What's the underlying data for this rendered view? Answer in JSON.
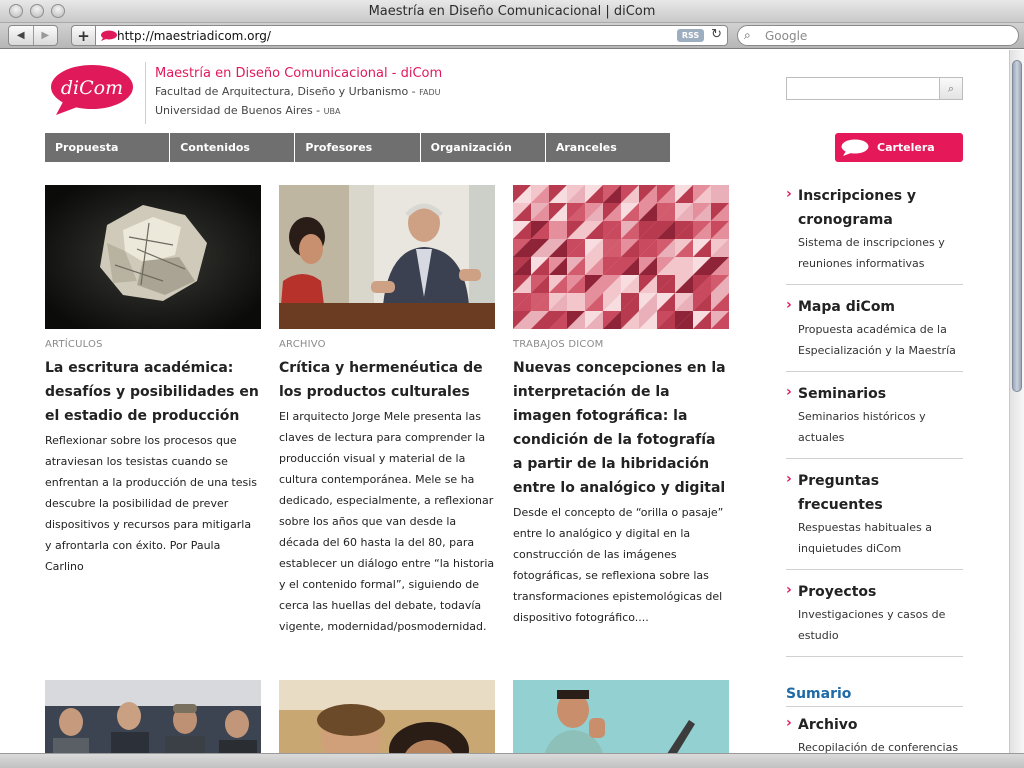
{
  "browser": {
    "window_title": "Maestría en Diseño Comunicacional | diCom",
    "url": "http://maestriadicom.org/",
    "rss_label": "RSS",
    "search_placeholder": "Google"
  },
  "site": {
    "logo_text": "diCom",
    "title": "Maestría en Diseño Comunicacional - diCom",
    "subtitle1": "Facultad de Arquitectura, Diseño y Urbanismo - ",
    "subtitle1_small": "FADU",
    "subtitle2": "Universidad de Buenos Aires - ",
    "subtitle2_small": "UBA"
  },
  "nav": {
    "items": [
      "Propuesta",
      "Contenidos",
      "Profesores",
      "Organización",
      "Aranceles"
    ],
    "cartelera": "Cartelera"
  },
  "articles": [
    {
      "category": "ARTÍCULOS",
      "title": "La escritura académica: desafíos y posibilidades en el estadio de producción",
      "body": "Reflexionar sobre los procesos que atraviesan los tesistas cuando se enfrentan a la producción de una tesis descubre la posibilidad de prever dispositivos y recursos para mitigarla y afrontarla con éxito. Por Paula Carlino"
    },
    {
      "category": "ARCHIVO",
      "title": "Crítica y hermenéutica de los productos culturales",
      "body": "El arquitecto Jorge Mele presenta las claves de lectura para comprender la producción visual y material de la cultura contemporánea. Mele se ha dedicado, especialmente, a reflexionar sobre los años que van desde la década del 60 hasta la del 80, para establecer un diálogo entre “la historia y el contenido formal”, siguiendo de cerca las huellas del debate, todavía vigente, modernidad/posmodernidad."
    },
    {
      "category": "TRABAJOS DICOM",
      "title": "Nuevas concepciones en la interpretación de la imagen fotográfica: la condición de la fotografía a partir de la hibridación entre lo analógico y digital",
      "body": "Desde el concepto de “orilla o pasaje” entre lo analógico y digital en la construcción de las imágenes fotográficas, se reflexiona sobre las transformaciones epistemológicas del dispositivo fotográfico...."
    }
  ],
  "sidebar": {
    "items": [
      {
        "title": "Inscripciones y cronograma",
        "desc": "Sistema de inscripciones y reuniones informativas"
      },
      {
        "title": "Mapa diCom",
        "desc": "Propuesta académica de la Especialización y la Maestría"
      },
      {
        "title": "Seminarios",
        "desc": "Seminarios históricos y actuales"
      },
      {
        "title": "Preguntas frecuentes",
        "desc": "Respuestas habituales a inquietudes diCom"
      },
      {
        "title": "Proyectos",
        "desc": "Investigaciones y casos de estudio"
      }
    ],
    "sumario": {
      "title": "Sumario",
      "items": [
        {
          "title": "Archivo",
          "desc": "Recopilación de conferencias"
        }
      ]
    }
  },
  "colors": {
    "brand": "#e0195a",
    "nav": "#6f6f6f",
    "sumario": "#1f6aa8"
  }
}
